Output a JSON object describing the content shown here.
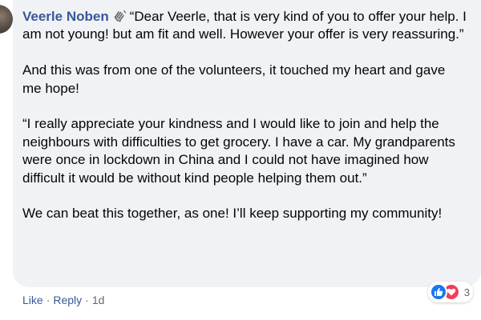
{
  "comment": {
    "author": "Veerle Noben",
    "author_badge_icon": "waving-hand-icon",
    "paragraphs": [
      "“Dear Veerle, that is very kind of you to offer your help. I am not young! but am fit and well. However your offer is very reassuring.”",
      "And this was from one of the volunteers, it touched my heart and gave me hope!",
      "“I really appreciate your kindness and I would like to join and help the neighbours with difficulties to get grocery. I have a car. My grandparents were once in lockdown in China and I could not have imagined how difficult it would be without kind people helping them out.”",
      "We can beat this together, as one! I’ll keep supporting my community!"
    ]
  },
  "reactions": {
    "icons": [
      "like-icon",
      "love-icon"
    ],
    "count": "3",
    "like_color": "#1877f2",
    "love_color": "#f33e58"
  },
  "actions": {
    "like_label": "Like",
    "separator": "·",
    "reply_label": "Reply",
    "time": "1d"
  },
  "colors": {
    "bubble_bg": "#f0f2f5",
    "author_link": "#385898",
    "meta_text": "#65676b"
  }
}
